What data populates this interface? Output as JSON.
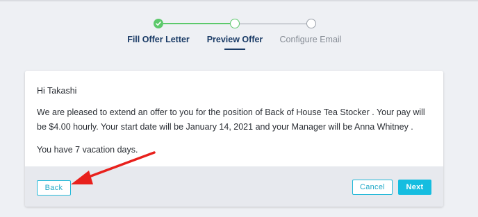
{
  "stepper": {
    "steps": [
      {
        "label": "Fill Offer Letter",
        "status": "complete"
      },
      {
        "label": "Preview Offer",
        "status": "current"
      },
      {
        "label": "Configure Email",
        "status": "pending"
      }
    ],
    "colors": {
      "complete": "#5cc96b",
      "active_text": "#1a3b66",
      "pending": "#9aa0a9"
    }
  },
  "letter": {
    "greeting": "Hi Takashi",
    "body": "We are pleased to extend an offer to you for the position of Back of House Tea Stocker . Your pay will be $4.00 hourly. Your start date will be January 14, 2021 and your Manager will be Anna Whitney .",
    "vacation": "You have 7 vacation days."
  },
  "footer": {
    "back_label": "Back",
    "cancel_label": "Cancel",
    "next_label": "Next"
  },
  "annotation": {
    "icon": "red-arrow-icon",
    "color": "#e8201c"
  }
}
